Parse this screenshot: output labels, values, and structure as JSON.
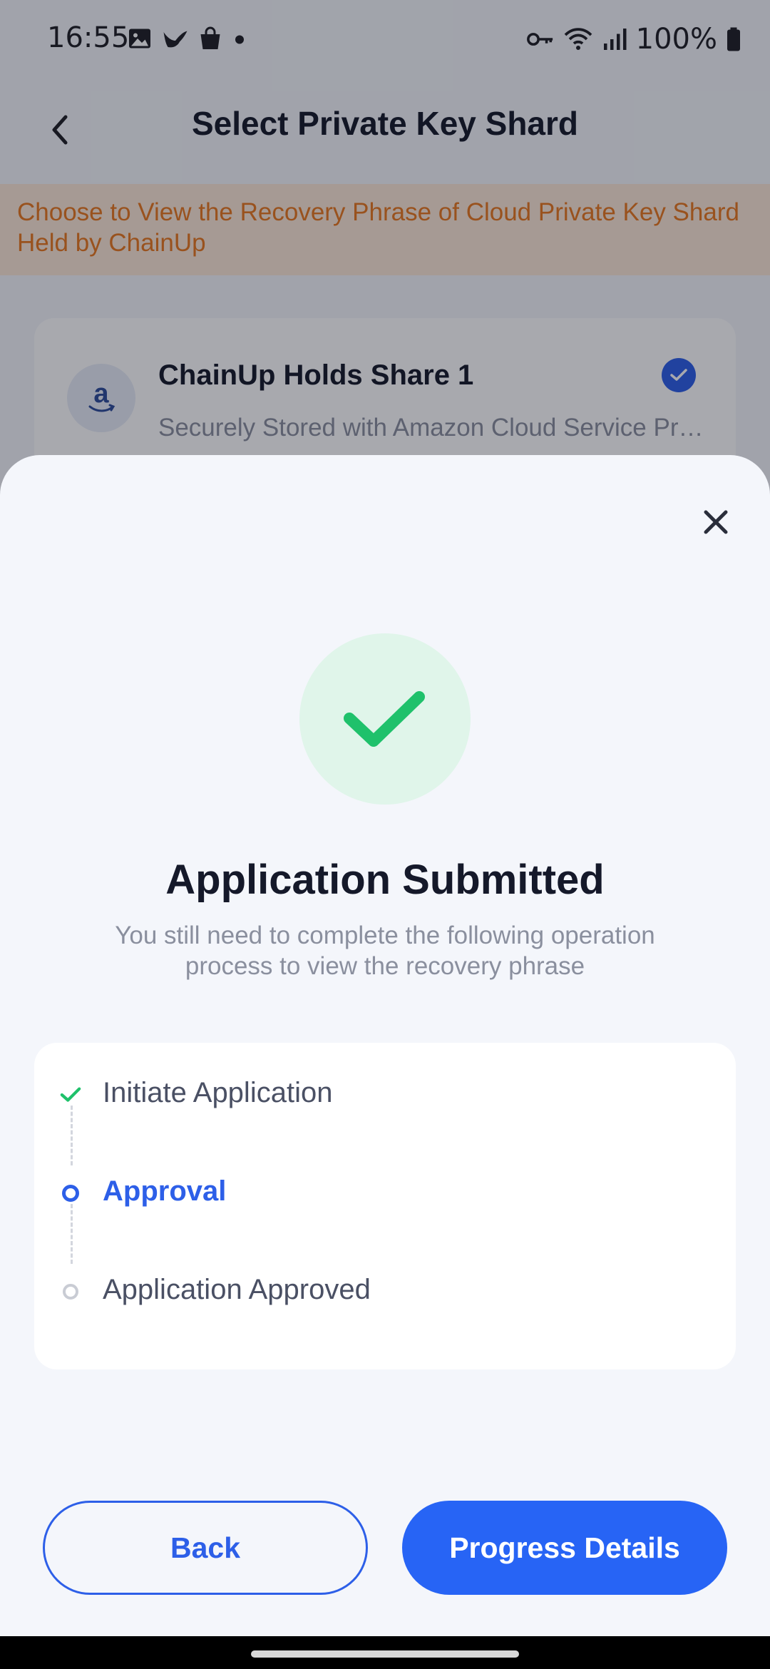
{
  "status_bar": {
    "time": "16:55",
    "battery": "100%",
    "icons_left": [
      "image-icon",
      "bird-icon",
      "shopping-bag-icon",
      "dot-icon"
    ],
    "icons_right": [
      "key-icon",
      "wifi-icon",
      "signal-icon",
      "battery-icon"
    ]
  },
  "header": {
    "title": "Select Private Key Shard",
    "back_icon": "chevron-left-icon"
  },
  "notice": {
    "text": "Choose to View the Recovery Phrase of Cloud Private Key Shard Held by ChainUp",
    "color": "#e8781e"
  },
  "shard_card": {
    "title": "ChainUp Holds Share 1",
    "subtitle": "Securely Stored with Amazon Cloud Service Provider",
    "logo_letter": "a",
    "selected": true
  },
  "sheet": {
    "close_icon": "close-icon",
    "success_icon": "checkmark-icon",
    "title": "Application Submitted",
    "subtitle": "You still need to complete the following operation process to view the recovery phrase",
    "steps": [
      {
        "label": "Initiate Application",
        "state": "done"
      },
      {
        "label": "Approval",
        "state": "active"
      },
      {
        "label": "Application Approved",
        "state": "pending"
      }
    ],
    "back_label": "Back",
    "progress_label": "Progress Details"
  },
  "colors": {
    "primary": "#2764f5",
    "success": "#1fc16b",
    "success_bg": "#e0f5ea",
    "text_dark": "#15192a",
    "text_muted": "#8a8f9e"
  }
}
